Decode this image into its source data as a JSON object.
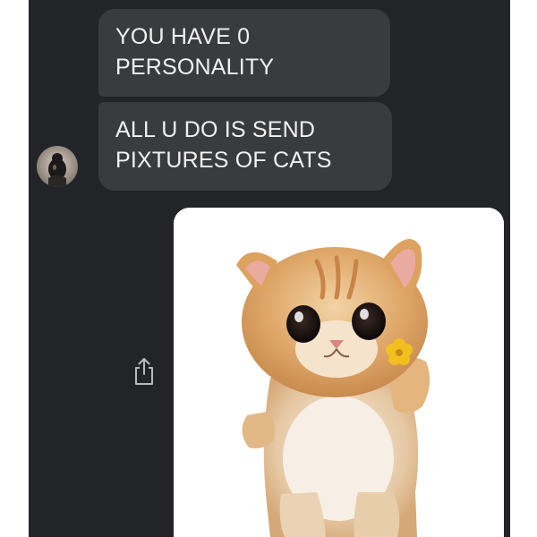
{
  "conversation": {
    "messages": [
      {
        "sender": "contact",
        "type": "text",
        "text": "YOU HAVE 0\nPERSONALITY"
      },
      {
        "sender": "contact",
        "type": "text",
        "text": "ALL U DO IS SEND\nPIXTURES OF CATS"
      },
      {
        "sender": "self",
        "type": "image",
        "image_subject": "crying-kitten"
      }
    ],
    "contact_avatar_icon": "contact-avatar",
    "share_icon": "share-icon"
  },
  "colors": {
    "panel_background": "#222427",
    "bubble_background": "#3a3b3d",
    "bubble_text": "#f1f1f1"
  }
}
